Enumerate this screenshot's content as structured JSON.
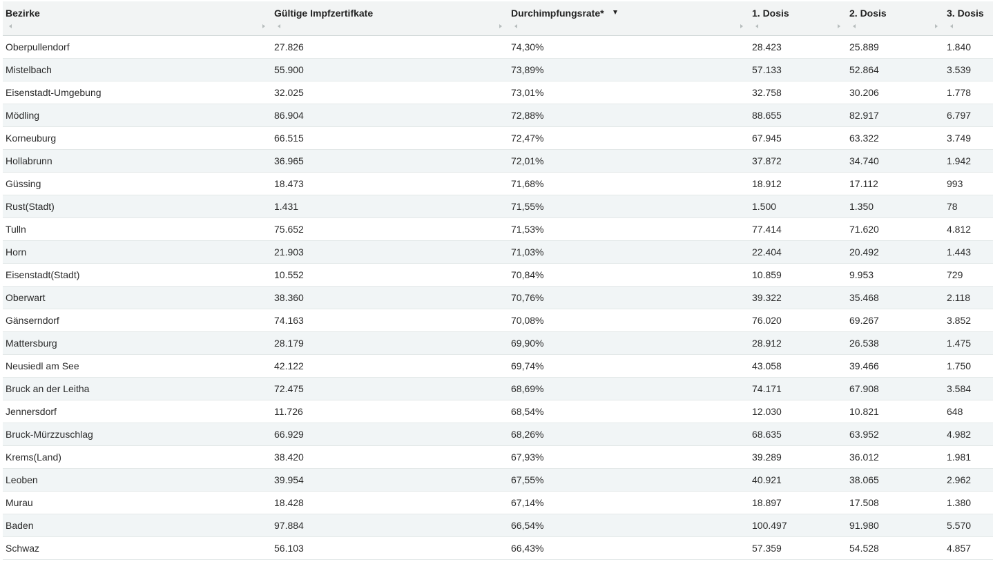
{
  "columns": [
    {
      "label": "Bezirke"
    },
    {
      "label": "Gültige Impfzertifkate"
    },
    {
      "label": "Durchimpfungsrate*"
    },
    {
      "label": "1. Dosis"
    },
    {
      "label": "2. Dosis"
    },
    {
      "label": "3. Dosis"
    }
  ],
  "sorted_column": 2,
  "rows": [
    [
      "Oberpullendorf",
      "27.826",
      "74,30%",
      "28.423",
      "25.889",
      "1.840"
    ],
    [
      "Mistelbach",
      "55.900",
      "73,89%",
      "57.133",
      "52.864",
      "3.539"
    ],
    [
      "Eisenstadt-Umgebung",
      "32.025",
      "73,01%",
      "32.758",
      "30.206",
      "1.778"
    ],
    [
      "Mödling",
      "86.904",
      "72,88%",
      "88.655",
      "82.917",
      "6.797"
    ],
    [
      "Korneuburg",
      "66.515",
      "72,47%",
      "67.945",
      "63.322",
      "3.749"
    ],
    [
      "Hollabrunn",
      "36.965",
      "72,01%",
      "37.872",
      "34.740",
      "1.942"
    ],
    [
      "Güssing",
      "18.473",
      "71,68%",
      "18.912",
      "17.112",
      "993"
    ],
    [
      "Rust(Stadt)",
      "1.431",
      "71,55%",
      "1.500",
      "1.350",
      "78"
    ],
    [
      "Tulln",
      "75.652",
      "71,53%",
      "77.414",
      "71.620",
      "4.812"
    ],
    [
      "Horn",
      "21.903",
      "71,03%",
      "22.404",
      "20.492",
      "1.443"
    ],
    [
      "Eisenstadt(Stadt)",
      "10.552",
      "70,84%",
      "10.859",
      "9.953",
      "729"
    ],
    [
      "Oberwart",
      "38.360",
      "70,76%",
      "39.322",
      "35.468",
      "2.118"
    ],
    [
      "Gänserndorf",
      "74.163",
      "70,08%",
      "76.020",
      "69.267",
      "3.852"
    ],
    [
      "Mattersburg",
      "28.179",
      "69,90%",
      "28.912",
      "26.538",
      "1.475"
    ],
    [
      "Neusiedl am See",
      "42.122",
      "69,74%",
      "43.058",
      "39.466",
      "1.750"
    ],
    [
      "Bruck an der Leitha",
      "72.475",
      "68,69%",
      "74.171",
      "67.908",
      "3.584"
    ],
    [
      "Jennersdorf",
      "11.726",
      "68,54%",
      "12.030",
      "10.821",
      "648"
    ],
    [
      "Bruck-Mürzzuschlag",
      "66.929",
      "68,26%",
      "68.635",
      "63.952",
      "4.982"
    ],
    [
      "Krems(Land)",
      "38.420",
      "67,93%",
      "39.289",
      "36.012",
      "1.981"
    ],
    [
      "Leoben",
      "39.954",
      "67,55%",
      "40.921",
      "38.065",
      "2.962"
    ],
    [
      "Murau",
      "18.428",
      "67,14%",
      "18.897",
      "17.508",
      "1.380"
    ],
    [
      "Baden",
      "97.884",
      "66,54%",
      "100.497",
      "91.980",
      "5.570"
    ],
    [
      "Schwaz",
      "56.103",
      "66,43%",
      "57.359",
      "54.528",
      "4.857"
    ]
  ]
}
